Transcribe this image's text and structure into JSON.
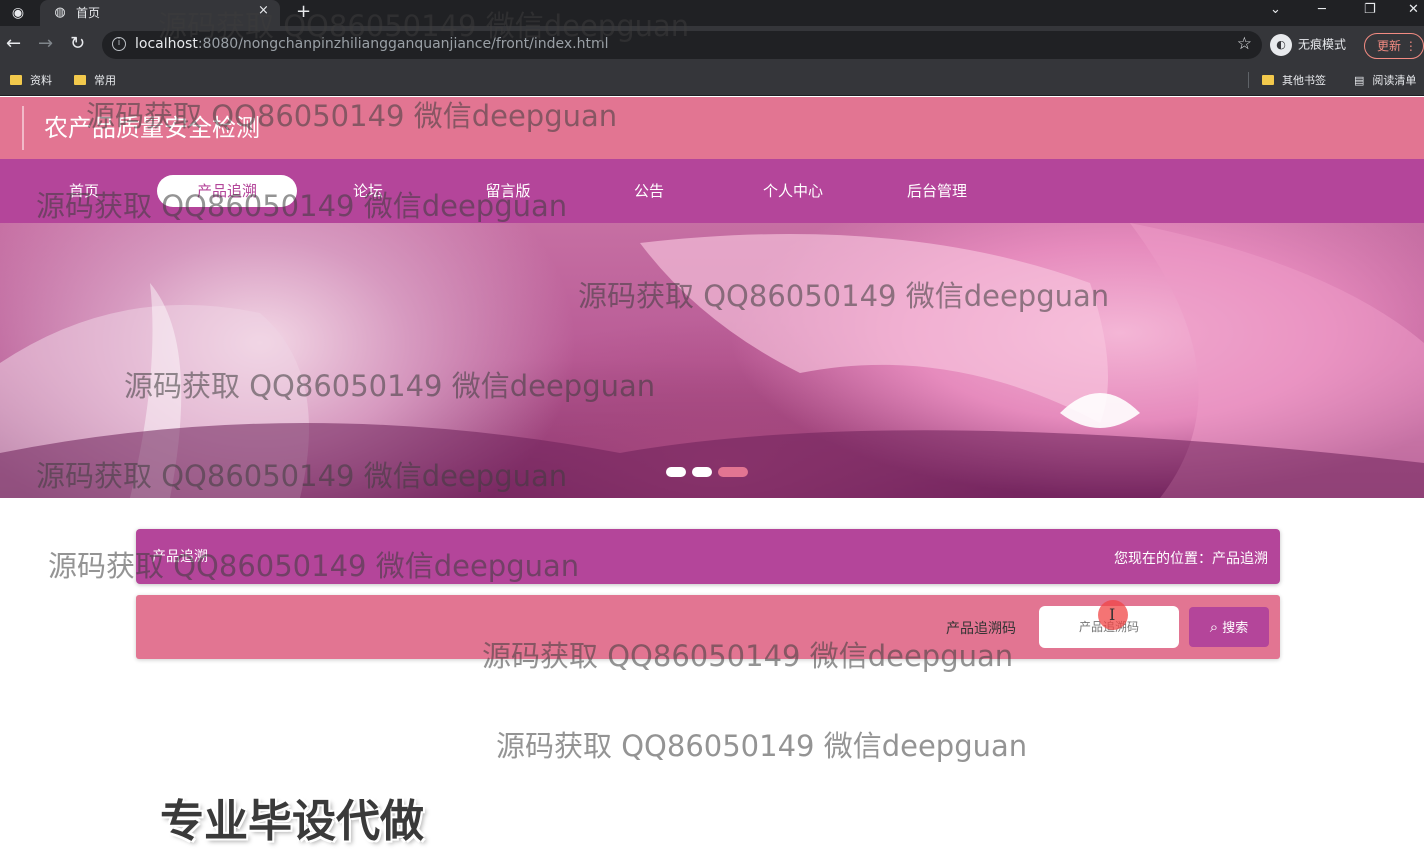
{
  "browser": {
    "tab_title": "首页",
    "tab_close": "×",
    "new_tab": "+",
    "url_host": "localhost",
    "url_rest": ":8080/nongchanpinzhiliangganquanjiance/front/index.html",
    "profile_label": "无痕模式",
    "update_label": "更新",
    "bookmarks": [
      "资料",
      "常用",
      "其他书签",
      "阅读清单"
    ]
  },
  "site": {
    "logo": "农产品质量安全检测",
    "nav": [
      "首页",
      "产品追溯",
      "论坛",
      "留言版",
      "公告",
      "个人中心",
      "后台管理"
    ],
    "active_nav": "产品追溯",
    "banner_slides_count": 3,
    "banner_active_slide": 3
  },
  "section": {
    "title": "产品追溯",
    "location": "您现在的位置：产品追溯"
  },
  "search": {
    "label": "产品追溯码",
    "placeholder": "产品追溯码",
    "button": "搜索"
  },
  "overlay": {
    "promo": "专业毕设代做",
    "watermark": "源码获取 QQ86050149 微信deepguan"
  },
  "colors": {
    "header": "#e27592",
    "nav": "#b4459a",
    "accent": "#b4459a"
  }
}
